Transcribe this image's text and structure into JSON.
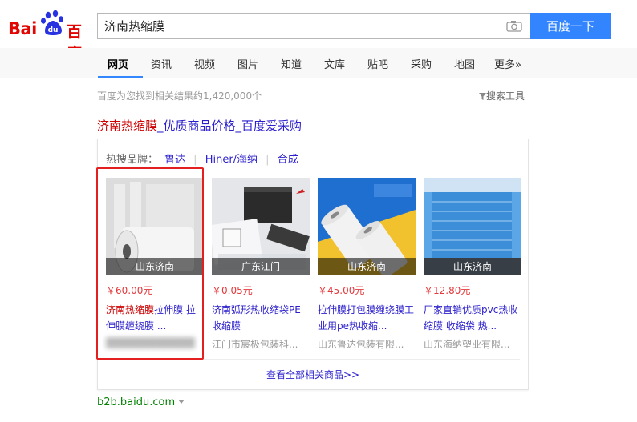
{
  "header": {
    "logo_text_left": "Bai",
    "logo_text_paw": "du",
    "logo_text_cn": "百度",
    "search_value": "济南热缩膜",
    "search_button": "百度一下"
  },
  "nav": {
    "items": [
      "网页",
      "资讯",
      "视频",
      "图片",
      "知道",
      "文库",
      "贴吧",
      "采购",
      "地图",
      "更多»"
    ],
    "active": "网页"
  },
  "stats": "百度为您找到相关结果约1,420,000个",
  "tools": "搜索工具",
  "result": {
    "title_hl": "济南热缩膜",
    "title_rest": "_优质商品价格_百度爱采购"
  },
  "card": {
    "brands_label": "热搜品牌：",
    "brands": [
      "鲁达",
      "Hiner/海纳",
      "合成"
    ],
    "products": [
      {
        "location": "山东济南",
        "price": "￥60.00元",
        "name_hl": "济南热缩膜",
        "name_rest": "拉伸膜 拉伸膜缠绕膜 ...",
        "shop": "████████████"
      },
      {
        "location": "广东江门",
        "price": "￥0.05元",
        "name_hl": "",
        "name_rest": "济南弧形热收缩袋PE收缩膜",
        "shop": "江门市宸极包装科..."
      },
      {
        "location": "山东济南",
        "price": "￥45.00元",
        "name_hl": "",
        "name_rest": "拉伸膜打包膜缠绕膜工业用pe热收缩...",
        "shop": "山东鲁达包装有限..."
      },
      {
        "location": "山东济南",
        "price": "￥12.80元",
        "name_hl": "",
        "name_rest": "厂家直销优质pvc热收缩膜 收缩袋 热...",
        "shop": "山东海纳塑业有限..."
      }
    ],
    "see_all": "查看全部相关商品>>"
  },
  "domain": "b2b.baidu.com"
}
